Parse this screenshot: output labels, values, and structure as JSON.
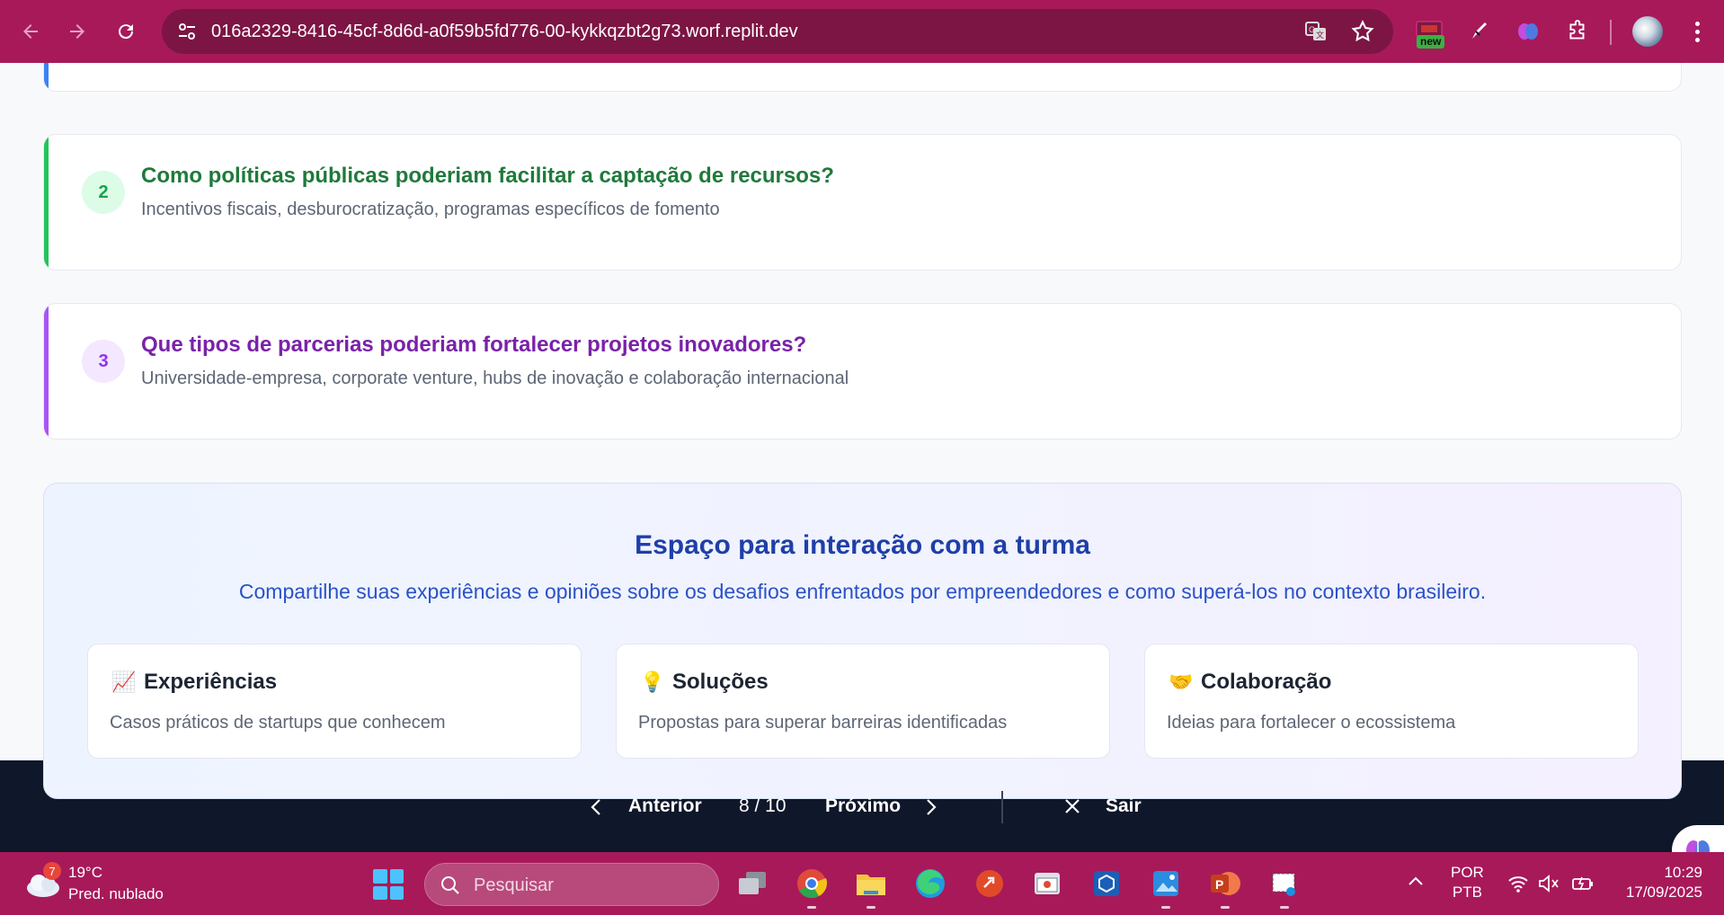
{
  "browser": {
    "url": "016a2329-8416-45cf-8d6d-a0f59b5fd776-00-kykkqzbt2g73.worf.replit.dev",
    "new_badge": "new",
    "accent_color": "#a8195a"
  },
  "questions": [
    {
      "number": "2",
      "title": "Como políticas públicas poderiam facilitar a captação de recursos?",
      "answer": "Incentivos fiscais, desburocratização, programas específicos de fomento",
      "color": "#1f7a3b"
    },
    {
      "number": "3",
      "title": "Que tipos de parcerias poderiam fortalecer projetos inovadores?",
      "answer": "Universidade-empresa, corporate venture, hubs de inovação e colaboração internacional",
      "color": "#7a22a8"
    }
  ],
  "interaction": {
    "title": "Espaço para interação com a turma",
    "subtitle": "Compartilhe suas experiências e opiniões sobre os desafios enfrentados por empreendedores e como superá-los no contexto brasileiro.",
    "cards": [
      {
        "icon": "chart-icon",
        "emoji": "📈",
        "title": "Experiências",
        "desc": "Casos práticos de startups que conhecem"
      },
      {
        "icon": "lightbulb-icon",
        "emoji": "💡",
        "title": "Soluções",
        "desc": "Propostas para superar barreiras identificadas"
      },
      {
        "icon": "handshake-icon",
        "emoji": "🤝",
        "title": "Colaboração",
        "desc": "Ideias para fortalecer o ecossistema"
      }
    ]
  },
  "navigation": {
    "prev_label": "Anterior",
    "page_indicator": "8 / 10",
    "next_label": "Próximo",
    "exit_label": "Sair"
  },
  "taskbar": {
    "weather_temp": "19°C",
    "weather_condition": "Pred. nublado",
    "weather_badge": "7",
    "search_placeholder": "Pesquisar",
    "language_line1": "POR",
    "language_line2": "PTB",
    "time": "10:29",
    "date": "17/09/2025"
  }
}
